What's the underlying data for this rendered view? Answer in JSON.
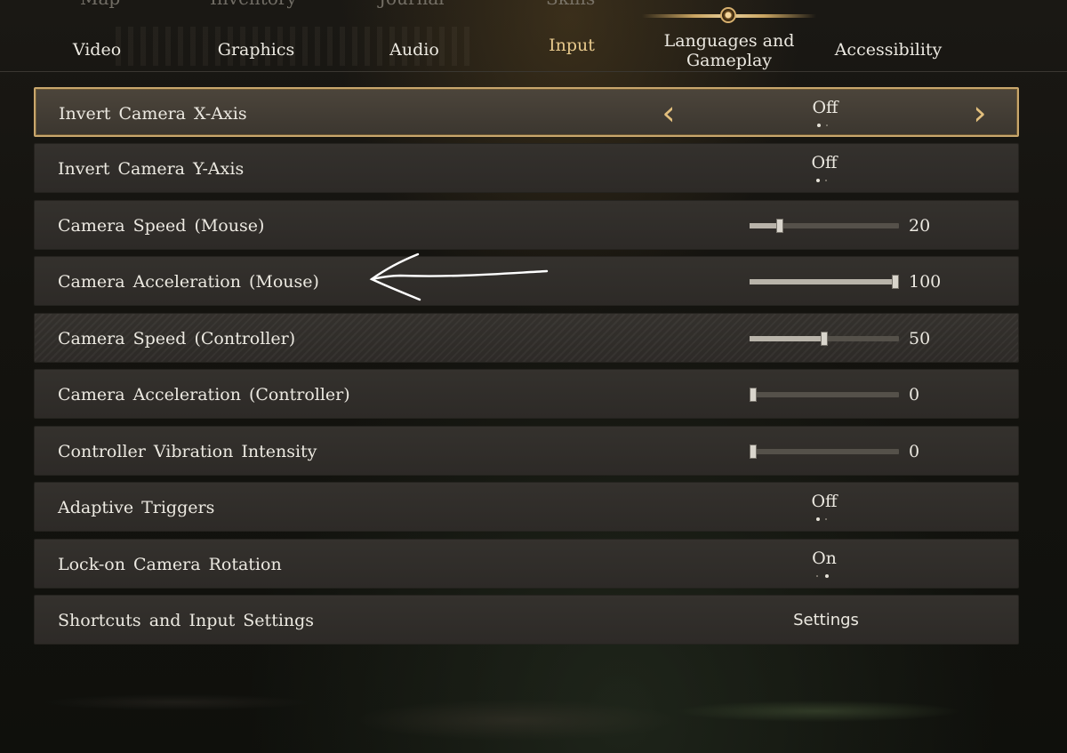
{
  "top_menu": [
    "Map",
    "Inventory",
    "Journal",
    "Skills"
  ],
  "tabs": [
    {
      "label": "Video"
    },
    {
      "label": "Graphics"
    },
    {
      "label": "Audio"
    },
    {
      "label": "Input",
      "active": true
    },
    {
      "label": "Languages and Gameplay"
    },
    {
      "label": "Accessibility"
    }
  ],
  "rows": [
    {
      "label": "Invert Camera X-Axis",
      "type": "toggle",
      "value": "Off",
      "option_index": 0,
      "option_count": 2,
      "selected": true
    },
    {
      "label": "Invert Camera Y-Axis",
      "type": "toggle",
      "value": "Off",
      "option_index": 0,
      "option_count": 2
    },
    {
      "label": "Camera Speed (Mouse)",
      "type": "slider",
      "value": "20",
      "min": 0,
      "max": 100,
      "level": 20
    },
    {
      "label": "Camera Acceleration (Mouse)",
      "type": "slider",
      "value": "100",
      "min": 0,
      "max": 100,
      "level": 100
    },
    {
      "label": "Camera Speed (Controller)",
      "type": "slider",
      "value": "50",
      "min": 0,
      "max": 100,
      "level": 50
    },
    {
      "label": "Camera Acceleration (Controller)",
      "type": "slider",
      "value": "0",
      "min": 0,
      "max": 100,
      "level": 0
    },
    {
      "label": "Controller Vibration Intensity",
      "type": "slider",
      "value": "0",
      "min": 0,
      "max": 100,
      "level": 0
    },
    {
      "label": "Adaptive Triggers",
      "type": "toggle",
      "value": "Off",
      "option_index": 0,
      "option_count": 2
    },
    {
      "label": "Lock-on Camera Rotation",
      "type": "toggle",
      "value": "On",
      "option_index": 1,
      "option_count": 2
    },
    {
      "label": "Shortcuts and Input Settings",
      "type": "link",
      "value": "Settings"
    }
  ],
  "icons": {
    "prev": "chevron-left-icon",
    "next": "chevron-right-icon",
    "annotation": "hand-drawn-arrow-icon"
  },
  "colors": {
    "accent": "#e2bf7d",
    "active_tab": "#e7c98c",
    "row_bg": "#2f2c29",
    "selected_border": "#c9a76d",
    "annotation": "#ffffff"
  }
}
